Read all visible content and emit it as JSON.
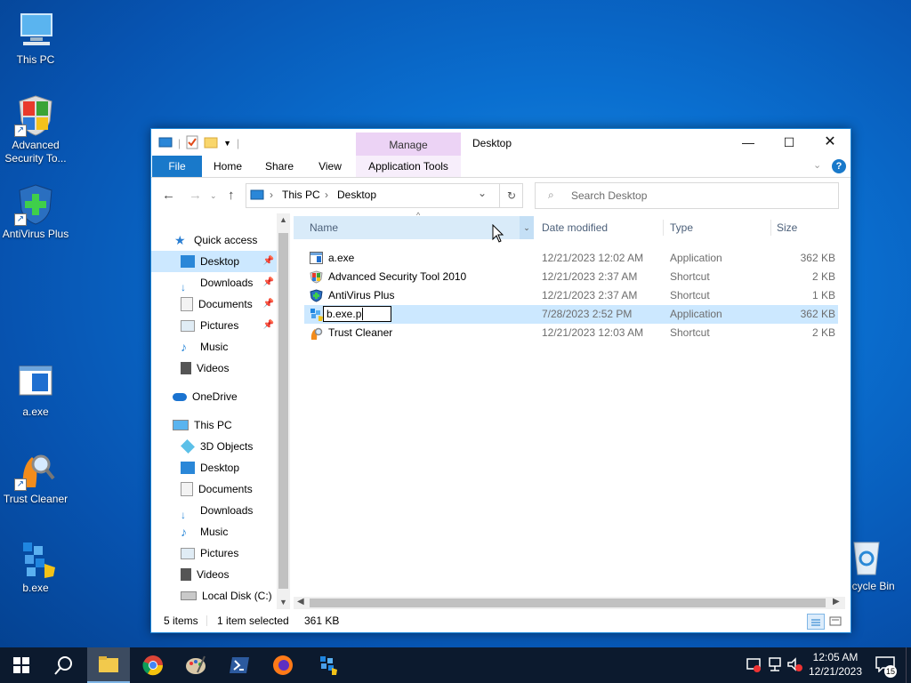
{
  "desktop": {
    "icons": [
      {
        "label": "This PC"
      },
      {
        "label": "Advanced Security To..."
      },
      {
        "label": "AntiVirus Plus"
      },
      {
        "label": "a.exe"
      },
      {
        "label": "Trust Cleaner"
      },
      {
        "label": "b.exe"
      },
      {
        "label": "Recycle Bin"
      }
    ]
  },
  "window": {
    "title": "Desktop",
    "contextual_tab_group": "Manage",
    "ribbon_tabs": [
      "File",
      "Home",
      "Share",
      "View",
      "Application Tools"
    ],
    "breadcrumb": [
      "This PC",
      "Desktop"
    ],
    "search_placeholder": "Search Desktop",
    "nav": {
      "quick_access": "Quick access",
      "quick_items": [
        "Desktop",
        "Downloads",
        "Documents",
        "Pictures",
        "Music",
        "Videos"
      ],
      "onedrive": "OneDrive",
      "this_pc": "This PC",
      "pc_items": [
        "3D Objects",
        "Desktop",
        "Documents",
        "Downloads",
        "Music",
        "Pictures",
        "Videos",
        "Local Disk (C:)"
      ]
    },
    "columns": [
      "Name",
      "Date modified",
      "Type",
      "Size"
    ],
    "files": [
      {
        "name": "a.exe",
        "date": "12/21/2023 12:02 AM",
        "type": "Application",
        "size": "362 KB"
      },
      {
        "name": "Advanced Security Tool 2010",
        "date": "12/21/2023 2:37 AM",
        "type": "Shortcut",
        "size": "2 KB"
      },
      {
        "name": "AntiVirus Plus",
        "date": "12/21/2023 2:37 AM",
        "type": "Shortcut",
        "size": "1 KB"
      },
      {
        "name": "b.exe.p",
        "date": "7/28/2023 2:52 PM",
        "type": "Application",
        "size": "362 KB"
      },
      {
        "name": "Trust Cleaner",
        "date": "12/21/2023 12:03 AM",
        "type": "Shortcut",
        "size": "2 KB"
      }
    ],
    "status": {
      "items": "5 items",
      "selected": "1 item selected",
      "size": "361 KB"
    }
  },
  "taskbar": {
    "time": "12:05 AM",
    "date": "12/21/2023",
    "notification_count": "15"
  },
  "colors": {
    "accent": "#1979ca",
    "selection": "#cce8ff",
    "manage_tab": "#ecd3f5"
  }
}
